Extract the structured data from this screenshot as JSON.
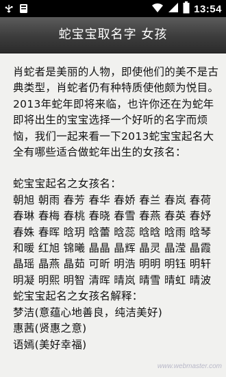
{
  "status_bar": {
    "time": "13:54",
    "icons": [
      "usb-icon",
      "notification-icon",
      "wifi-icon",
      "signal-icon",
      "battery-icon"
    ]
  },
  "header": {
    "title": "蛇宝宝取名字 女孩"
  },
  "article": {
    "intro": "肖蛇者是美丽的人物，即使他们的美不是古典类型，肖蛇者仍有种特质使他颇为悦目。2013年蛇年即将来临，也许你还在为蛇年即将出生的宝宝选择一个好听的名字而烦恼，我们一起来看一下2013蛇宝宝起名大全有哪些适合做蛇年出生的女孩名：",
    "list_heading": "蛇宝宝起名之女孩名：",
    "names": "朝旭 朝雨 春芳 春华 春娇 春兰 春岚 春荷 春琳 春梅 春桃 春晓 春雪 春燕 春英 春妤 春姝 春晖 晗玥 晗蕾 晗蕊 晗晗 晗雨 晗琴 和暖 红旭 锦曦 晶晶 晶辉 晶灵 晶滢 晶霞 晶瑶 晶燕 晶茹 可昕 明浩 明明 明钰 明轩 明凝 明熙 明智 清晖 晴岚 晴雪 晴虹 晴波",
    "explain_heading": "蛇宝宝起名之女孩名解释：",
    "explain_1": "梦洁(意蕴心地善良，纯洁美好)",
    "explain_2": "惠茜(贤惠之意)",
    "explain_3": "语嫣(美好幸福)"
  },
  "watermark": "www.webmaster.com"
}
